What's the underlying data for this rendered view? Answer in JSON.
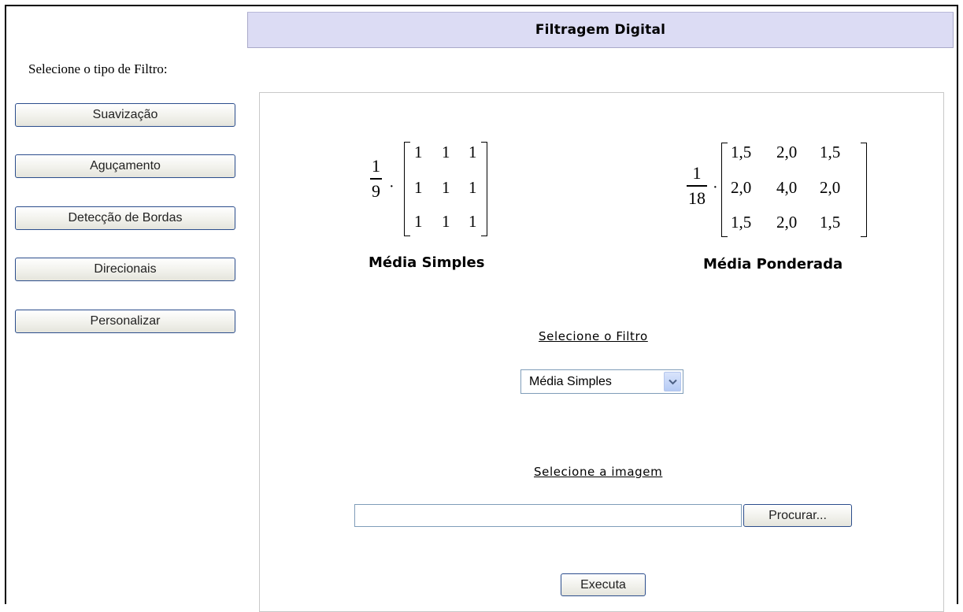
{
  "header": {
    "title": "Filtragem Digital"
  },
  "sidebar": {
    "prompt": "Selecione o tipo de Filtro:",
    "buttons": [
      {
        "label": "Suavização"
      },
      {
        "label": "Aguçamento"
      },
      {
        "label": "Detecção de Bordas"
      },
      {
        "label": "Direcionais"
      },
      {
        "label": "Personalizar"
      }
    ]
  },
  "filters": {
    "simple": {
      "caption": "Média Simples",
      "factor_num": "1",
      "factor_den": "9",
      "dot": "·",
      "matrix": [
        [
          "1",
          "1",
          "1"
        ],
        [
          "1",
          "1",
          "1"
        ],
        [
          "1",
          "1",
          "1"
        ]
      ]
    },
    "weighted": {
      "caption": "Média Ponderada",
      "factor_num": "1",
      "factor_den": "18",
      "dot": "·",
      "matrix": [
        [
          "1,5",
          "2,0",
          "1,5"
        ],
        [
          "2,0",
          "4,0",
          "2,0"
        ],
        [
          "1,5",
          "2,0",
          "1,5"
        ]
      ]
    }
  },
  "filter_select": {
    "label": "Selecione o Filtro",
    "value": "Média Simples"
  },
  "image_select": {
    "label": "Selecione a imagem",
    "value": "",
    "browse_label": "Procurar..."
  },
  "execute": {
    "label": "Executa"
  },
  "icons": {
    "dropdown": "chevron-down-icon"
  }
}
